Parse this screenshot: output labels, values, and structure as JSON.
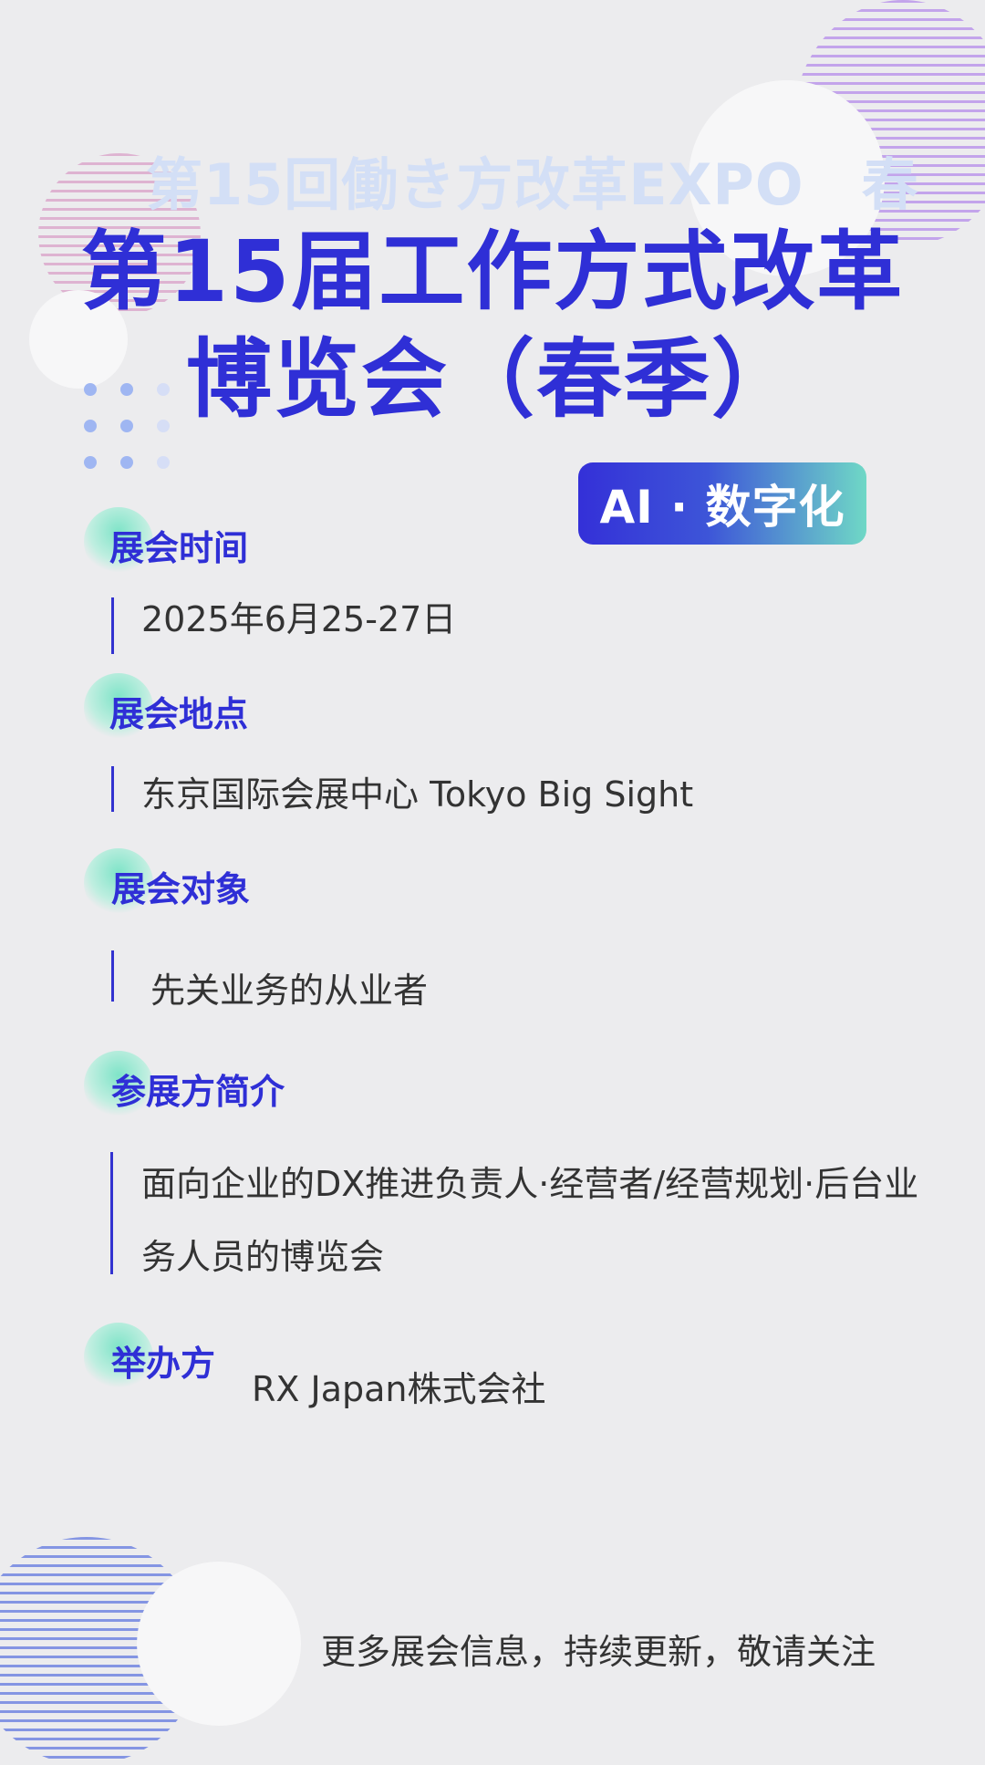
{
  "ghost_title": "第15回働き方改革EXPO　春",
  "title_line1": "第15届工作方式改革",
  "title_line2": "博览会（春季）",
  "badge": "AI · 数字化",
  "sections": [
    {
      "title": "展会时间",
      "text": "2025年6月25-27日"
    },
    {
      "title": "展会地点",
      "text": "东京国际会展中心  Tokyo Big Sight"
    },
    {
      "title": "展会对象",
      "text": "先关业务的从业者"
    },
    {
      "title": "参展方简介",
      "text": "面向企业的DX推进负责人·经营者/经营规划·后台业务人员的博览会"
    },
    {
      "title": "举办方",
      "text": "RX Japan株式会社"
    }
  ],
  "footer": "更多展会信息，持续更新，敬请关注",
  "colors": {
    "accent": "#2f2fd6",
    "teal": "#6fd8c6",
    "background": "#ececee"
  }
}
